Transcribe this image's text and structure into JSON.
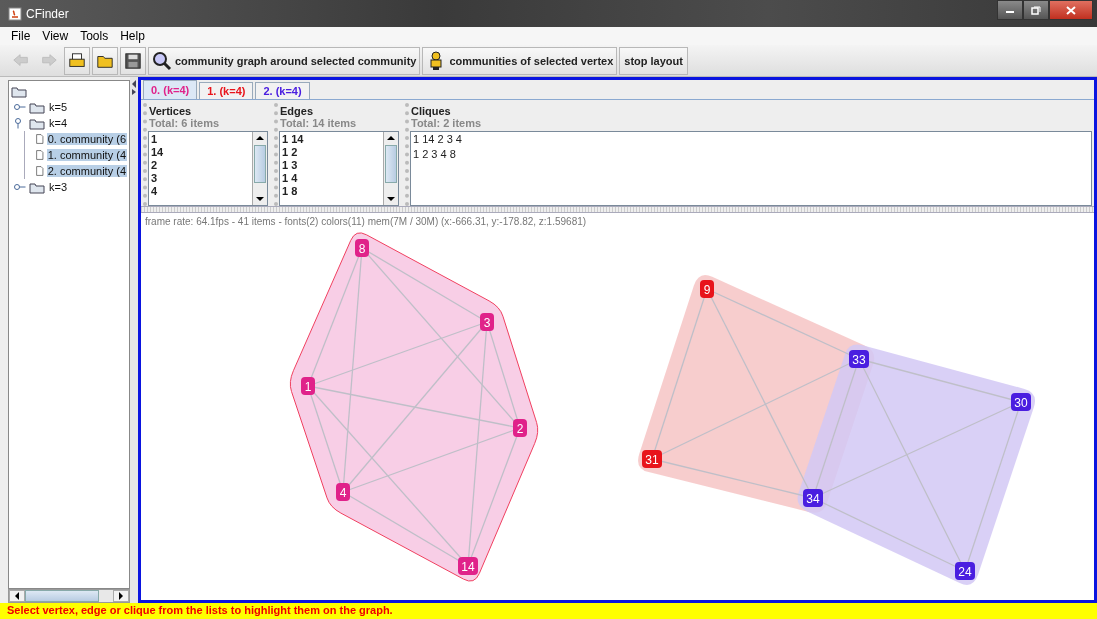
{
  "window": {
    "title": "CFinder"
  },
  "menu": [
    "File",
    "View",
    "Tools",
    "Help"
  ],
  "toolbar": [
    {
      "kind": "icon",
      "disabled": true
    },
    {
      "kind": "icon",
      "disabled": true
    },
    {
      "kind": "icon",
      "disabled": false
    },
    {
      "kind": "icon",
      "disabled": false
    },
    {
      "kind": "icon",
      "disabled": false
    },
    {
      "kind": "text",
      "label": "community graph around selected community",
      "disabled": false
    },
    {
      "kind": "text",
      "label": "communities of selected vertex",
      "disabled": false
    },
    {
      "kind": "plain",
      "label": "stop layout",
      "disabled": false
    }
  ],
  "tree": {
    "children": [
      {
        "label": "k=5",
        "expanded": false
      },
      {
        "label": "k=4",
        "expanded": true,
        "children": [
          {
            "label": "0. community (6",
            "selected": true
          },
          {
            "label": "1. community (4",
            "selected": true
          },
          {
            "label": "2. community (4",
            "selected": true
          }
        ]
      },
      {
        "label": "k=3",
        "expanded": false
      }
    ]
  },
  "tabs": [
    {
      "label": "0. (k=4)",
      "color": "#e0228a",
      "selected": true
    },
    {
      "label": "1. (k=4)",
      "color": "#e8141b",
      "selected": false
    },
    {
      "label": "2. (k=4)",
      "color": "#4a1ee0",
      "selected": false
    }
  ],
  "lists": [
    {
      "title": "Vertices",
      "total": "Total: 6 items",
      "items": [
        "1",
        "14",
        "2",
        "3",
        "4"
      ],
      "scrollbar": true
    },
    {
      "title": "Edges",
      "total": "Total: 14 items",
      "items": [
        "1 14",
        "1 2",
        "1 3",
        "1 4",
        "1 8"
      ],
      "scrollbar": true
    },
    {
      "title": "Cliques",
      "total": "Total: 2 items",
      "items": [
        "1 14 2 3 4",
        "1 2 3 4 8"
      ],
      "scrollbar": false
    }
  ],
  "graph": {
    "info": "frame rate: 64.1fps - 41 items - fonts(2) colors(11) mem(7M / 30M) (x:-666.31, y:-178.82, z:1.59681)",
    "vertices": [
      {
        "label": "8",
        "color": "#e0228a"
      },
      {
        "label": "3",
        "color": "#e0228a"
      },
      {
        "label": "1",
        "color": "#e0228a"
      },
      {
        "label": "2",
        "color": "#e0228a"
      },
      {
        "label": "4",
        "color": "#e0228a"
      },
      {
        "label": "14",
        "color": "#e0228a"
      },
      {
        "label": "9",
        "color": "#e8141b"
      },
      {
        "label": "33",
        "color": "#4a1ee0"
      },
      {
        "label": "31",
        "color": "#e8141b"
      },
      {
        "label": "34",
        "color": "#4a1ee0"
      },
      {
        "label": "30",
        "color": "#4a1ee0"
      },
      {
        "label": "24",
        "color": "#4a1ee0"
      }
    ],
    "communities": [
      {
        "color": "#f7c6e2",
        "outline": true
      },
      {
        "color": "#f6c4c4",
        "outline": false
      },
      {
        "color": "#d2c8f4",
        "outline": false
      }
    ]
  },
  "status_bar": "Select vertex, edge or clique from the lists to highlight them on the graph."
}
